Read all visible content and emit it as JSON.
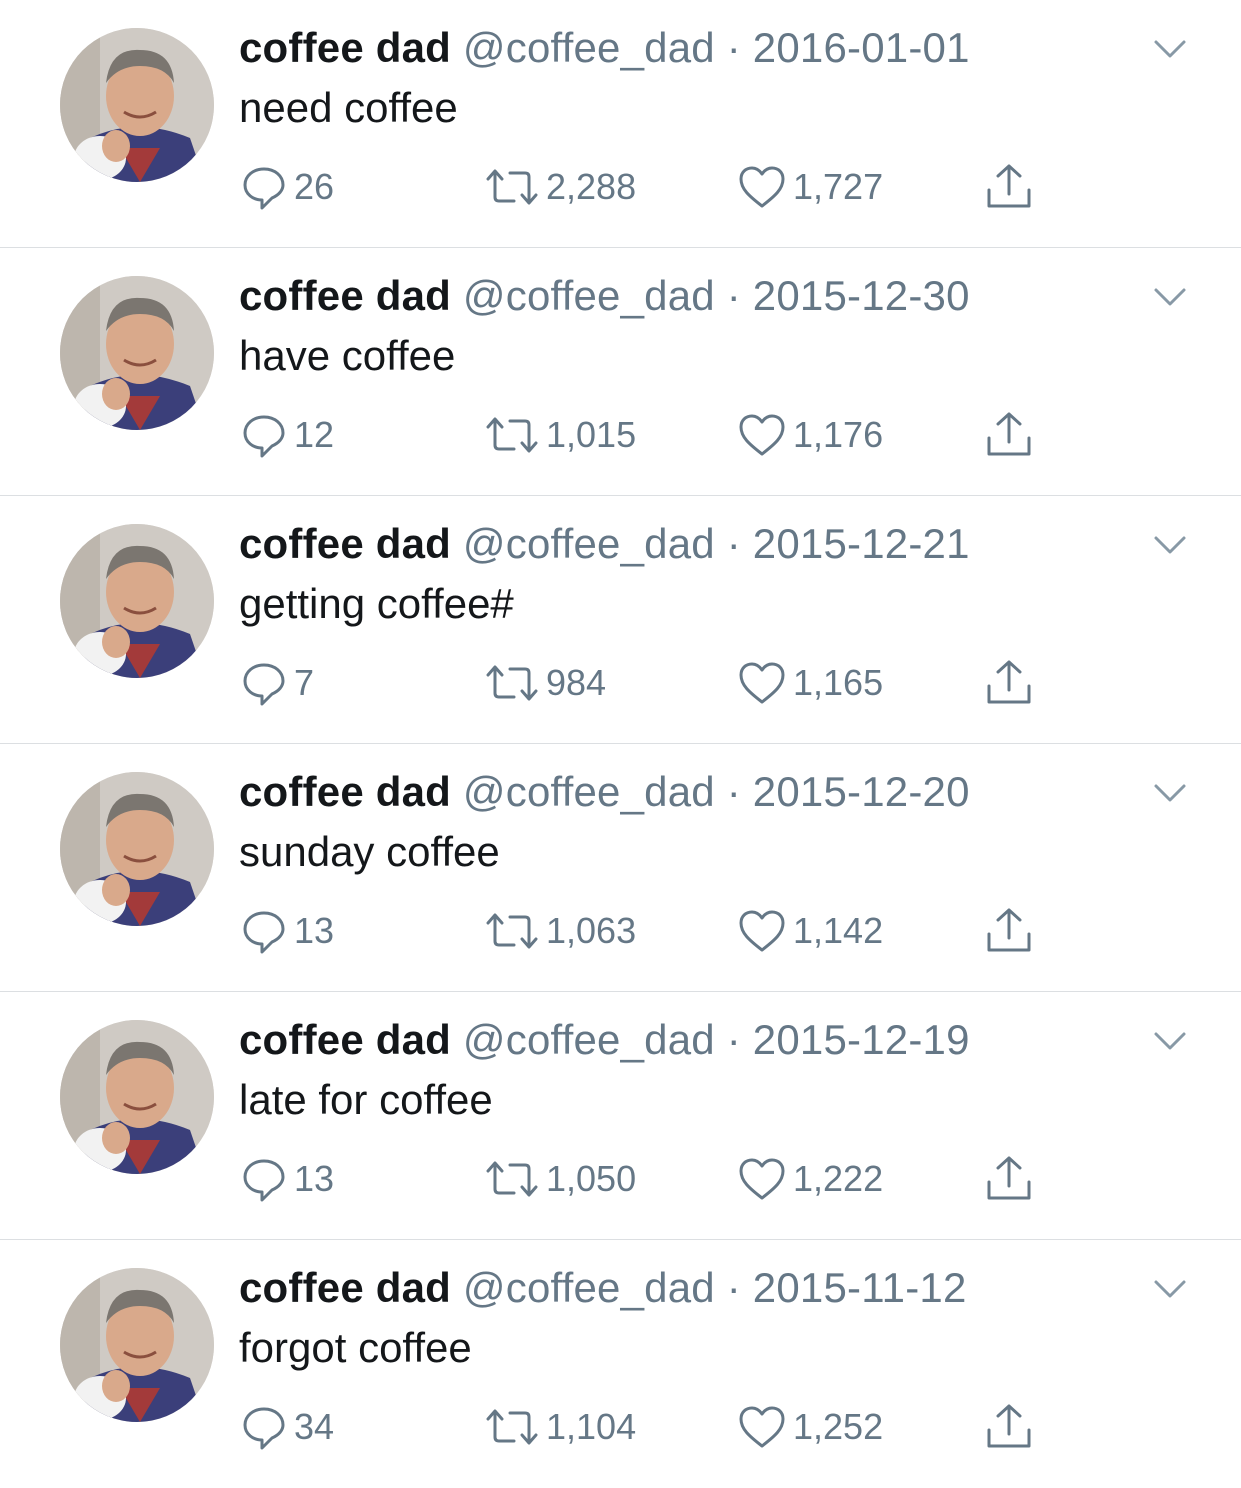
{
  "colors": {
    "name": "#14171a",
    "meta": "#657786",
    "icon": "#657786",
    "divider": "#dcdfe2"
  },
  "icons": {
    "reply": "speech-bubble-icon",
    "retweet": "retweet-arrows-icon",
    "like": "heart-icon",
    "share": "share-upload-icon",
    "menu": "chevron-down-icon"
  },
  "tweets": [
    {
      "name": "coffee dad",
      "handle": "@coffee_dad",
      "separator": "·",
      "date": "2016-01-01",
      "text": "need coffee",
      "replies": "26",
      "retweets": "2,288",
      "likes": "1,727"
    },
    {
      "name": "coffee dad",
      "handle": "@coffee_dad",
      "separator": "·",
      "date": "2015-12-30",
      "text": "have coffee",
      "replies": "12",
      "retweets": "1,015",
      "likes": "1,176"
    },
    {
      "name": "coffee dad",
      "handle": "@coffee_dad",
      "separator": "·",
      "date": "2015-12-21",
      "text": "getting coffee#",
      "replies": "7",
      "retweets": "984",
      "likes": "1,165"
    },
    {
      "name": "coffee dad",
      "handle": "@coffee_dad",
      "separator": "·",
      "date": "2015-12-20",
      "text": "sunday coffee",
      "replies": "13",
      "retweets": "1,063",
      "likes": "1,142"
    },
    {
      "name": "coffee dad",
      "handle": "@coffee_dad",
      "separator": "·",
      "date": "2015-12-19",
      "text": "late for coffee",
      "replies": "13",
      "retweets": "1,050",
      "likes": "1,222"
    },
    {
      "name": "coffee dad",
      "handle": "@coffee_dad",
      "separator": "·",
      "date": "2015-11-12",
      "text": "forgot coffee",
      "replies": "34",
      "retweets": "1,104",
      "likes": "1,252"
    }
  ]
}
